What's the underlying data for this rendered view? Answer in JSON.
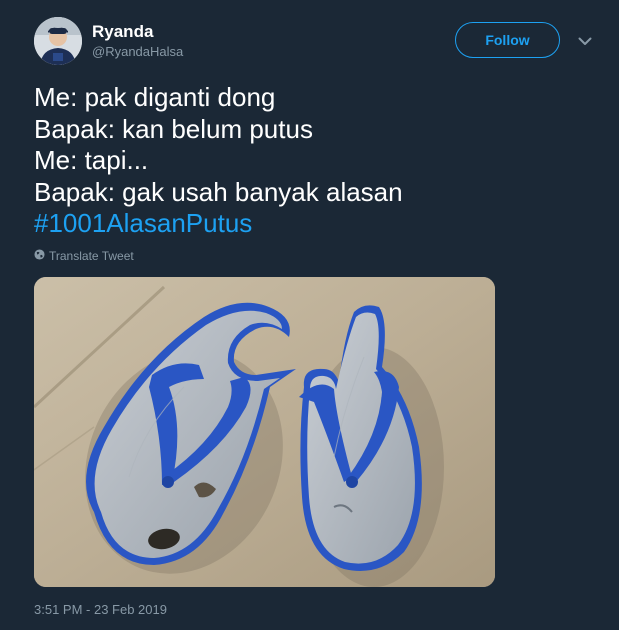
{
  "author": {
    "name": "Ryanda",
    "handle": "@RyandaHalsa"
  },
  "follow_label": "Follow",
  "tweet": {
    "lines": [
      "Me: pak diganti dong",
      "Bapak: kan belum putus",
      "Me: tapi...",
      "Bapak: gak usah banyak alasan"
    ],
    "hashtag": "#1001AlasanPutus",
    "translate_label": "Translate Tweet",
    "timestamp": "3:51 PM - 23 Feb 2019"
  },
  "icons": {
    "caret": "chevron-down-icon",
    "translate": "globe-icon"
  },
  "colors": {
    "background": "#1b2836",
    "accent": "#1da1f2",
    "secondary_text": "#8899a6",
    "primary_text": "#ffffff",
    "strap_blue": "#2a56c4"
  }
}
